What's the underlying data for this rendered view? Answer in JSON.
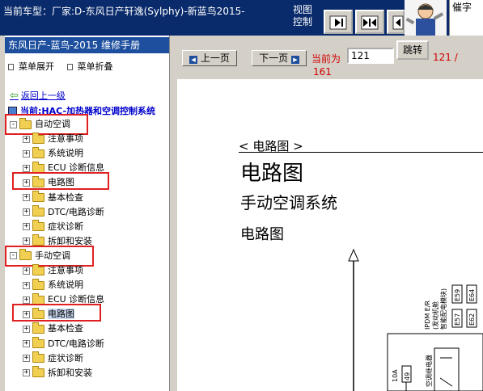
{
  "topbar": {
    "car_model_label": "当前车型：厂家:D-东风日产轩逸(Sylphy)-新蓝鸟2015-",
    "view_control_label": "视图控制",
    "help_label": "催字"
  },
  "left": {
    "manual_title": "东风日产-蓝鸟-2015 维修手册",
    "menu_expand": "菜单展开",
    "menu_collapse": "菜单折叠",
    "back_link": "返回上一级",
    "current_path": "当前:HAC-加热器和空调控制系统",
    "tree": [
      {
        "label": "自动空调",
        "level": 0,
        "expander": "-"
      },
      {
        "label": "注意事项",
        "level": 1,
        "expander": "+"
      },
      {
        "label": "系统说明",
        "level": 1,
        "expander": "+"
      },
      {
        "label": "ECU 诊断信息",
        "level": 1,
        "expander": "+"
      },
      {
        "label": "电路图",
        "level": 1,
        "expander": "+"
      },
      {
        "label": "基本检查",
        "level": 1,
        "expander": "+"
      },
      {
        "label": "DTC/电路诊断",
        "level": 1,
        "expander": "+"
      },
      {
        "label": "症状诊断",
        "level": 1,
        "expander": "+"
      },
      {
        "label": "拆卸和安装",
        "level": 1,
        "expander": "+"
      },
      {
        "label": "手动空调",
        "level": 0,
        "expander": "-"
      },
      {
        "label": "注意事项",
        "level": 1,
        "expander": "+"
      },
      {
        "label": "系统说明",
        "level": 1,
        "expander": "+"
      },
      {
        "label": "ECU 诊断信息",
        "level": 1,
        "expander": "+"
      },
      {
        "label": "电路图",
        "level": 1,
        "expander": "+"
      },
      {
        "label": "基本检查",
        "level": 1,
        "expander": "+"
      },
      {
        "label": "DTC/电路诊断",
        "level": 1,
        "expander": "+"
      },
      {
        "label": "症状诊断",
        "level": 1,
        "expander": "+"
      },
      {
        "label": "拆卸和安装",
        "level": 1,
        "expander": "+"
      }
    ]
  },
  "toolbar": {
    "prev_page": "上一页",
    "next_page": "下一页",
    "current_label": "当前为",
    "page_value": "121",
    "jump": "跳转",
    "page_count": "121 /",
    "page_total": "161"
  },
  "document": {
    "section_tag": "< 电路图 >",
    "title": "电路图",
    "subtitle": "手动空调系统",
    "heading": "电路图",
    "diagram_labels": {
      "ipdm": "IPDM E/R",
      "ipdm_sub1": "(发动机舱",
      "ipdm_sub2": "智能配电模块)",
      "c1": "E59",
      "c2": "E64",
      "c3": "E57",
      "c4": "E62",
      "fuse": "10A",
      "fuse_no": "49",
      "relay": "空调继电器"
    }
  },
  "colors": {
    "banner": "#0a2b6b",
    "title_bar": "#1d4f9e",
    "highlight": "#e02020",
    "link": "#0000cc",
    "page_red": "#d00000"
  }
}
